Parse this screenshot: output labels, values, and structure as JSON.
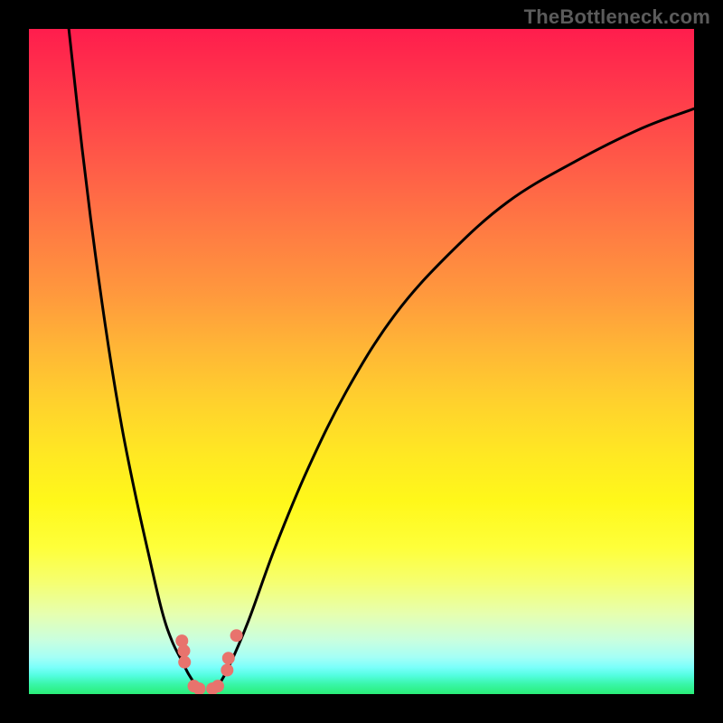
{
  "watermark": "TheBottleneck.com",
  "colors": {
    "bg": "#000000",
    "curve": "#000000",
    "marker_fill": "#e8736d",
    "marker_stroke": "#c95a54",
    "gradient_top": "#ff1d4d",
    "gradient_bottom": "#2aee78"
  },
  "chart_data": {
    "type": "line",
    "title": "",
    "xlabel": "",
    "ylabel": "",
    "xlim": [
      0,
      100
    ],
    "ylim": [
      0,
      100
    ],
    "grid": false,
    "legend": false,
    "note": "Bottleneck-style V curve. Axes are unlabeled in the source image; x is an unspecified component scale (0–100), y is bottleneck severity (0 = no bottleneck / green, 100 = severe / red). Values below are read off the rendered curve.",
    "series": [
      {
        "name": "left-branch",
        "x": [
          6,
          8,
          10,
          12,
          14,
          16,
          18,
          20,
          21.5,
          23,
          24,
          25,
          26
        ],
        "y": [
          100,
          82,
          66,
          52,
          40,
          30,
          21,
          12.5,
          8,
          5,
          3,
          1.5,
          0.5
        ]
      },
      {
        "name": "right-branch",
        "x": [
          28,
          30,
          33,
          37,
          42,
          48,
          55,
          63,
          72,
          82,
          92,
          100
        ],
        "y": [
          0.5,
          4,
          11,
          22,
          34,
          46,
          57,
          66,
          74,
          80,
          85,
          88
        ]
      }
    ],
    "markers": {
      "note": "Salmon-colored data points clustered near the trough of the V.",
      "points": [
        {
          "x": 23.0,
          "y": 8.0
        },
        {
          "x": 23.3,
          "y": 6.5
        },
        {
          "x": 23.4,
          "y": 4.8
        },
        {
          "x": 24.8,
          "y": 1.2
        },
        {
          "x": 25.6,
          "y": 0.8
        },
        {
          "x": 27.6,
          "y": 0.8
        },
        {
          "x": 28.4,
          "y": 1.2
        },
        {
          "x": 29.8,
          "y": 3.6
        },
        {
          "x": 30.0,
          "y": 5.4
        },
        {
          "x": 31.2,
          "y": 8.8
        }
      ]
    }
  }
}
